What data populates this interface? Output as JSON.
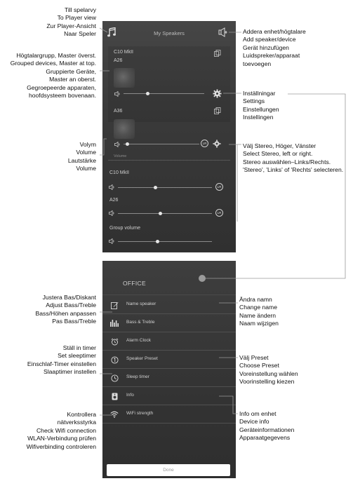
{
  "annotations": {
    "to_player": [
      "Till spelarvy",
      "To Player view",
      "Zur Player-Ansicht",
      "Naar Speler"
    ],
    "add_speaker": [
      "Addera enhet/högtalare",
      "Add speaker/device",
      "Gerät hinzufügen",
      "Luidspreker/apparaat",
      "toevoegen"
    ],
    "grouped": [
      "Högtalargrupp, Master överst.",
      "Grouped devices, Master at top.",
      "Gruppierte Geräte,",
      "Master an oberst.",
      "Gegroepeerde apparaten,",
      "hoofdsysteem bovenaan."
    ],
    "settings": [
      "Inställningar",
      "Settings",
      "Einstellungen",
      "Instellingen"
    ],
    "volume": [
      "Volym",
      "Volume",
      "Lautstärke",
      "Volume"
    ],
    "stereo": [
      "Välj Stereo, Höger, Vänster",
      "Select Stereo, left or right.",
      "Stereo auswählen–Links/Rechts.",
      "'Stereo', 'Links' of 'Rechts' selecteren."
    ],
    "bass_treble": [
      "Justera Bas/Diskant",
      "Adjust Bass/Treble",
      "Bass/Höhen anpassen",
      "Pas Bass/Treble"
    ],
    "sleep": [
      "Ställ in timer",
      "Set sleeptimer",
      "Einschlaf-Timer einstellen",
      "Slaaptimer instellen"
    ],
    "wifi": [
      "Kontrollera",
      "nätverksstyrka",
      "Check Wifi connection",
      "WLAN-Verbindung prüfen",
      "Wifiverbinding controleren"
    ],
    "rename": [
      "Ändra namn",
      "Change name",
      "Name ändern",
      "Naam wijzigen"
    ],
    "preset": [
      "Välj Preset",
      "Choose Preset",
      "Voreinstellung wählen",
      "Voorinstelling kiezen"
    ],
    "info": [
      "Info om enhet",
      "Device info",
      "Geräteinformationen",
      "Apparaatgegevens"
    ]
  },
  "screen1": {
    "title": "My Speakers",
    "group_master": "C10 MkII",
    "group_slave": "A26",
    "speaker2": "A36",
    "speaker2_sub": "Volume",
    "vol_row1_label": "C10 MkII",
    "vol_row2_label": "A26",
    "group_volume_label": "Group volume",
    "lr_label": "LR",
    "volumes": {
      "group_master": 0.3,
      "speaker2": 0.05,
      "row1": 0.4,
      "row2": 0.45,
      "group": 0.42
    }
  },
  "screen2": {
    "title": "OFFICE",
    "menu": [
      "Name speaker",
      "Bass & Treble",
      "Alarm Clock",
      "Speaker Preset",
      "Sleep timer",
      "Info",
      "WiFi strength"
    ],
    "done": "Done"
  }
}
